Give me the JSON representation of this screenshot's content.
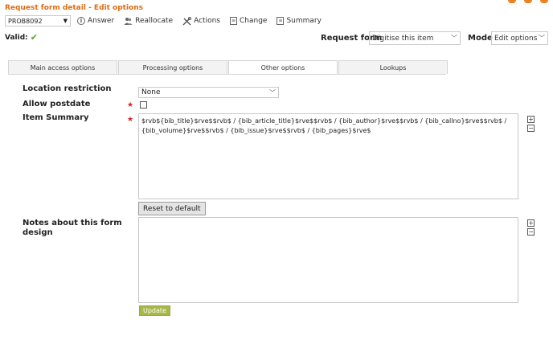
{
  "header": {
    "title": "Request form detail - Edit options",
    "request_id": "PROB8092",
    "valid_label": "Valid:"
  },
  "toolbar": {
    "answer": "Answer",
    "reallocate": "Reallocate",
    "actions": "Actions",
    "change": "Change",
    "summary": "Summary"
  },
  "request_form": {
    "label": "Request form",
    "value": "Digitise this item"
  },
  "mode": {
    "label": "Mode",
    "value": "Edit options"
  },
  "tabs": [
    {
      "label": "Main access options"
    },
    {
      "label": "Processing options"
    },
    {
      "label": "Other options"
    },
    {
      "label": "Lookups"
    }
  ],
  "fields": {
    "location_restriction": {
      "label": "Location restriction",
      "value": "None"
    },
    "allow_postdate": {
      "label": "Allow postdate"
    },
    "item_summary": {
      "label": "Item Summary",
      "value": "$rvb${bib_title}$rve$$rvb$ / {bib_article_title}$rve$$rvb$ / {bib_author}$rve$$rvb$ / {bib_callno}$rve$$rvb$ / {bib_volume}$rve$$rvb$ / {bib_issue}$rve$$rvb$ / {bib_pages}$rve$"
    },
    "notes": {
      "label": "Notes about this form design",
      "value": ""
    }
  },
  "buttons": {
    "reset": "Reset to default",
    "update": "Update"
  },
  "colors": {
    "accent": "#e06b12",
    "update_button": "#a8b74a",
    "required": "#dd2222",
    "valid_check": "#5aa02c"
  }
}
